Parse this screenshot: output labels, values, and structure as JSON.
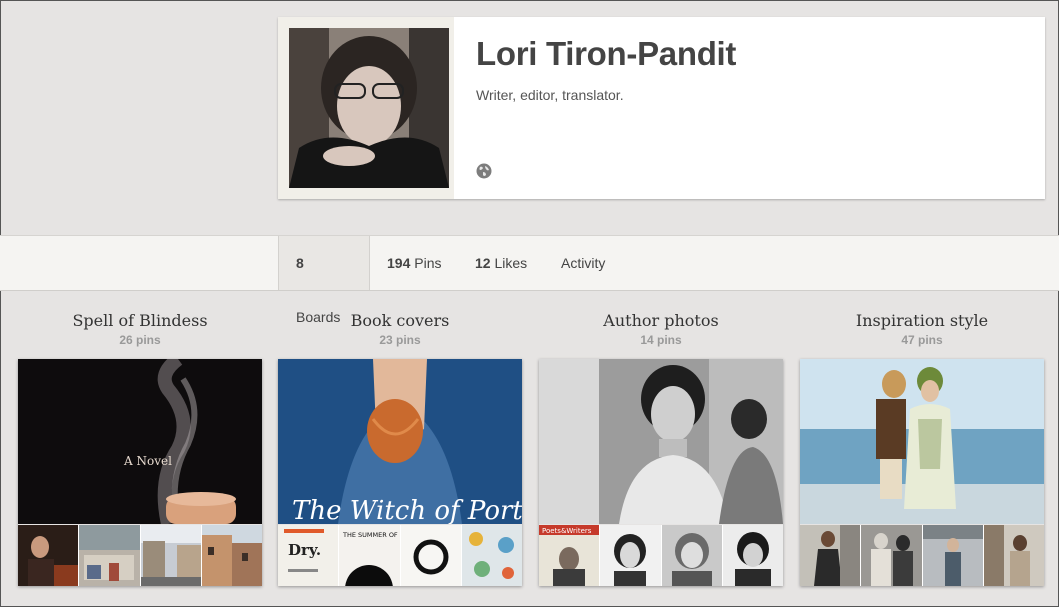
{
  "profile": {
    "name": "Lori Tiron-Pandit",
    "bio": "Writer, editor, translator.",
    "avatar_alt": "profile photo",
    "website_icon": "globe-icon"
  },
  "tabs": [
    {
      "count": "8",
      "label": "Boards"
    },
    {
      "count": "194",
      "label": "Pins"
    },
    {
      "count": "12",
      "label": "Likes"
    },
    {
      "count": "",
      "label": "Activity"
    }
  ],
  "boards": [
    {
      "title": "Spell of Blindess",
      "pins": "26 pins",
      "cover_text": "A Novel"
    },
    {
      "title": "Book covers",
      "pins": "23 pins",
      "cover_text": "The Witch of Portobello"
    },
    {
      "title": "Author photos",
      "pins": "14 pins"
    },
    {
      "title": "Inspiration style",
      "pins": "47 pins"
    }
  ],
  "thumb_texts": {
    "dry": "Dry.",
    "summer": "THE SUMMER OF UBUME",
    "poets": "Poets&Writers"
  },
  "colors": {
    "background": "#e6e4e3",
    "card": "#ffffff",
    "tabbar": "#f5f4f2",
    "muted": "#999999"
  }
}
